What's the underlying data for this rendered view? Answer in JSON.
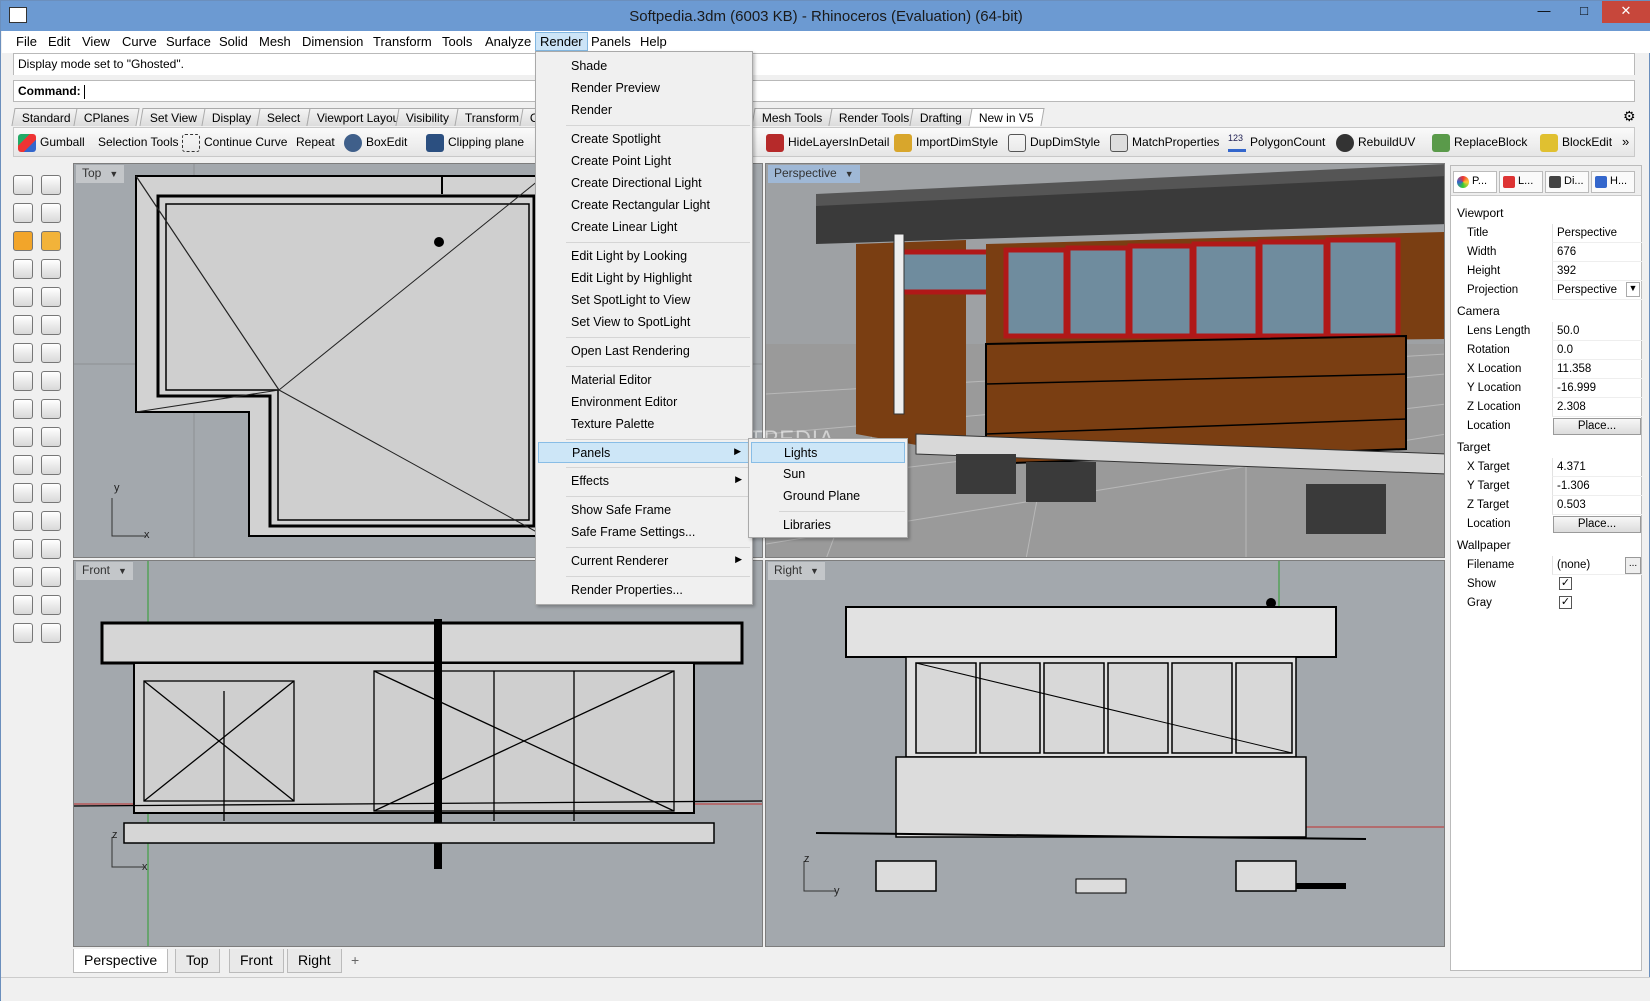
{
  "window": {
    "title": "Softpedia.3dm (6003 KB) - Rhinoceros (Evaluation) (64-bit)",
    "min": "—",
    "max": "□",
    "close": "✕"
  },
  "menubar": [
    "File",
    "Edit",
    "View",
    "Curve",
    "Surface",
    "Solid",
    "Mesh",
    "Dimension",
    "Transform",
    "Tools",
    "Analyze",
    "Render",
    "Panels",
    "Help"
  ],
  "command": {
    "history": "Display mode set to \"Ghosted\".",
    "prompt": "Command:"
  },
  "toolbar_tabs": [
    "Standard",
    "CPlanes",
    "Set View",
    "Display",
    "Select",
    "Viewport Layout",
    "Visibility",
    "Transform",
    "Cu",
    "Mesh Tools",
    "Render Tools",
    "Drafting",
    "New in V5"
  ],
  "toolbar_buttons_left": [
    "Gumball",
    "Selection Tools",
    "Continue Curve",
    "Repeat",
    "BoxEdit",
    "Clipping plane"
  ],
  "toolbar_buttons_right": [
    "HideLayersInDetail",
    "ImportDimStyle",
    "DupDimStyle",
    "MatchProperties",
    "PolygonCount",
    "RebuildUV",
    "ReplaceBlock",
    "BlockEdit"
  ],
  "polygon_count_badge": "123",
  "viewports": {
    "top": "Top",
    "perspective": "Perspective",
    "front": "Front",
    "right": "Right"
  },
  "axes": {
    "top": [
      "y",
      "x"
    ],
    "front": [
      "z",
      "x"
    ],
    "right": [
      "z",
      "y"
    ]
  },
  "render_menu": {
    "items": [
      "Shade",
      "Render Preview",
      "Render",
      "Create Spotlight",
      "Create Point Light",
      "Create Directional Light",
      "Create Rectangular Light",
      "Create Linear Light",
      "Edit Light by Looking",
      "Edit Light by Highlight",
      "Set SpotLight to View",
      "Set View to SpotLight",
      "Open Last Rendering",
      "Material Editor",
      "Environment Editor",
      "Texture Palette",
      "Panels",
      "Effects",
      "Show Safe Frame",
      "Safe Frame Settings...",
      "Current Renderer",
      "Render Properties..."
    ],
    "submenu_arrow": "▶"
  },
  "panels_submenu": [
    "Lights",
    "Sun",
    "Ground Plane",
    "Libraries"
  ],
  "properties_panel": {
    "tabs": [
      "P...",
      "L...",
      "Di...",
      "H..."
    ],
    "viewport": {
      "head": "Viewport",
      "rows": [
        [
          "Title",
          "Perspective"
        ],
        [
          "Width",
          "676"
        ],
        [
          "Height",
          "392"
        ],
        [
          "Projection",
          "Perspective"
        ]
      ]
    },
    "camera": {
      "head": "Camera",
      "rows": [
        [
          "Lens Length",
          "50.0"
        ],
        [
          "Rotation",
          "0.0"
        ],
        [
          "X Location",
          "11.358"
        ],
        [
          "Y Location",
          "-16.999"
        ],
        [
          "Z Location",
          "2.308"
        ]
      ],
      "location_label": "Location",
      "place_button": "Place..."
    },
    "target": {
      "head": "Target",
      "rows": [
        [
          "X Target",
          "4.371"
        ],
        [
          "Y Target",
          "-1.306"
        ],
        [
          "Z Target",
          "0.503"
        ]
      ],
      "location_label": "Location",
      "place_button": "Place..."
    },
    "wallpaper": {
      "head": "Wallpaper",
      "filename_label": "Filename",
      "filename_value": "(none)",
      "browse": "...",
      "show_label": "Show",
      "gray_label": "Gray",
      "show_checked": true,
      "gray_checked": true
    }
  },
  "bottom_tabs": [
    "Perspective",
    "Top",
    "Front",
    "Right",
    "+"
  ],
  "watermark": "SOFTPEDIA",
  "colors": {
    "titlebar": "#6c9ad2",
    "menu_highlight": "#cde6f7",
    "viewport_bg": "#a3a8ad",
    "perspective_label_bg": "#9fb8d6",
    "wall_brown": "#7a3e12",
    "window_red": "#b01818",
    "glass": "#6f8c9e"
  }
}
